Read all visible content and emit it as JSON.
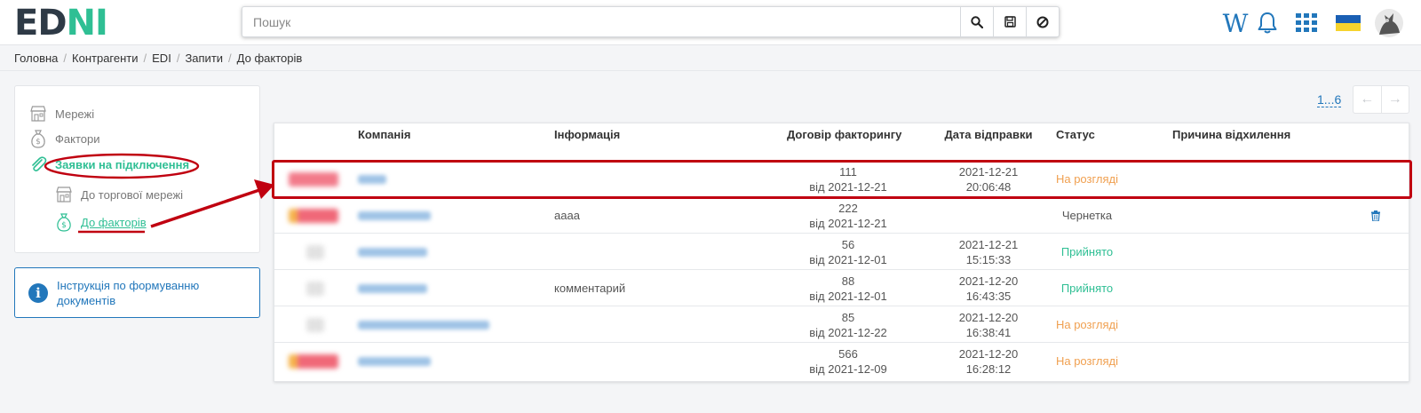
{
  "header": {
    "logo_left": "ED",
    "logo_right": "N",
    "logo_mid": "I",
    "search_placeholder": "Пошук",
    "wiki_label": "W"
  },
  "breadcrumb": [
    "Головна",
    "Контрагенти",
    "EDI",
    "Запити",
    "До факторів"
  ],
  "menu": {
    "items": [
      {
        "label": "Мережі",
        "icon": "store-icon"
      },
      {
        "label": "Фактори",
        "icon": "money-bag-icon"
      },
      {
        "label": "Заявки на підключення",
        "icon": "paperclip-icon"
      },
      {
        "label": "До торгової мережі",
        "icon": "store-icon"
      },
      {
        "label": "До факторів",
        "icon": "money-bag-icon"
      }
    ]
  },
  "info_box": {
    "text": "Інструкція по формуванню документів"
  },
  "pager": {
    "range": "1...6"
  },
  "table": {
    "headers": {
      "company": "Компанія",
      "info": "Інформація",
      "contract": "Договір факторингу",
      "date": "Дата відправки",
      "status": "Статус",
      "reason": "Причина відхилення"
    },
    "rows": [
      {
        "info": "",
        "contract_no": "111",
        "contract_date": "від 2021-12-21",
        "date": "2021-12-21",
        "time": "20:06:48",
        "status": "На розгляді",
        "status_type": "review"
      },
      {
        "info": "аааа",
        "contract_no": "222",
        "contract_date": "від 2021-12-21",
        "date": "",
        "time": "",
        "status": "Чернетка",
        "status_type": "draft"
      },
      {
        "info": "",
        "contract_no": "56",
        "contract_date": "від 2021-12-01",
        "date": "2021-12-21",
        "time": "15:15:33",
        "status": "Прийнято",
        "status_type": "ok"
      },
      {
        "info": "комментарий",
        "contract_no": "88",
        "contract_date": "від 2021-12-01",
        "date": "2021-12-20",
        "time": "16:43:35",
        "status": "Прийнято",
        "status_type": "ok"
      },
      {
        "info": "",
        "contract_no": "85",
        "contract_date": "від 2021-12-22",
        "date": "2021-12-20",
        "time": "16:38:41",
        "status": "На розгляді",
        "status_type": "review"
      },
      {
        "info": "",
        "contract_no": "566",
        "contract_date": "від 2021-12-09",
        "date": "2021-12-20",
        "time": "16:28:12",
        "status": "На розгляді",
        "status_type": "review"
      }
    ]
  },
  "colors": {
    "accent_green": "#2fbf94",
    "link_blue": "#2277bb",
    "review_orange": "#f0a050",
    "annotation_red": "#c00010"
  }
}
